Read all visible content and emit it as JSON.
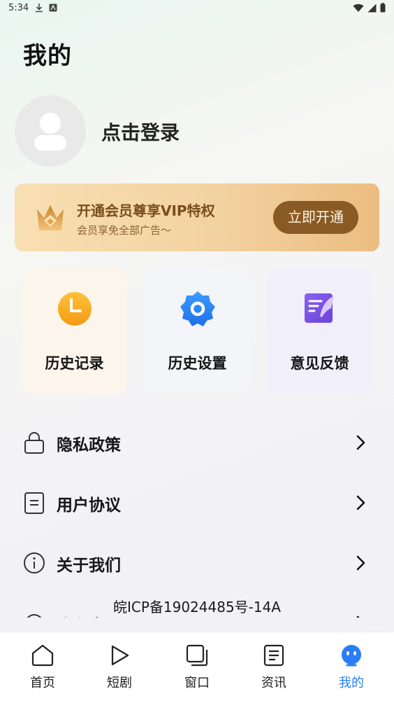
{
  "status_bar": {
    "time": "5:34",
    "left_icons": [
      "download-icon",
      "keyboard-icon"
    ],
    "right_icons": [
      "wifi-icon",
      "signal-icon",
      "battery-icon"
    ]
  },
  "page": {
    "title": "我的"
  },
  "profile": {
    "login_label": "点击登录",
    "avatar_icon": "user-avatar-icon"
  },
  "vip": {
    "icon": "crown-icon",
    "title": "开通会员尊享VIP特权",
    "subtitle": "会员享免全部广告～",
    "button_label": "立即开通",
    "colors": {
      "button": "#8a5a24",
      "title": "#7a4e1c"
    }
  },
  "quick_actions": [
    {
      "label": "历史记录",
      "icon": "clock-icon"
    },
    {
      "label": "历史设置",
      "icon": "gear-icon"
    },
    {
      "label": "意见反馈",
      "icon": "feedback-icon"
    }
  ],
  "menu": [
    {
      "label": "隐私政策",
      "icon": "lock-icon"
    },
    {
      "label": "用户协议",
      "icon": "document-icon"
    },
    {
      "label": "关于我们",
      "icon": "info-icon"
    },
    {
      "label": "隐私中心",
      "icon": "shield-icon"
    }
  ],
  "icp": "皖ICP备19024485号-14A",
  "tabs": [
    {
      "label": "首页",
      "icon": "home-icon"
    },
    {
      "label": "短剧",
      "icon": "play-icon"
    },
    {
      "label": "窗口",
      "icon": "window-icon"
    },
    {
      "label": "资讯",
      "icon": "news-icon"
    },
    {
      "label": "我的",
      "icon": "profile-icon",
      "active": true
    }
  ],
  "accent_color": "#2a7df6"
}
